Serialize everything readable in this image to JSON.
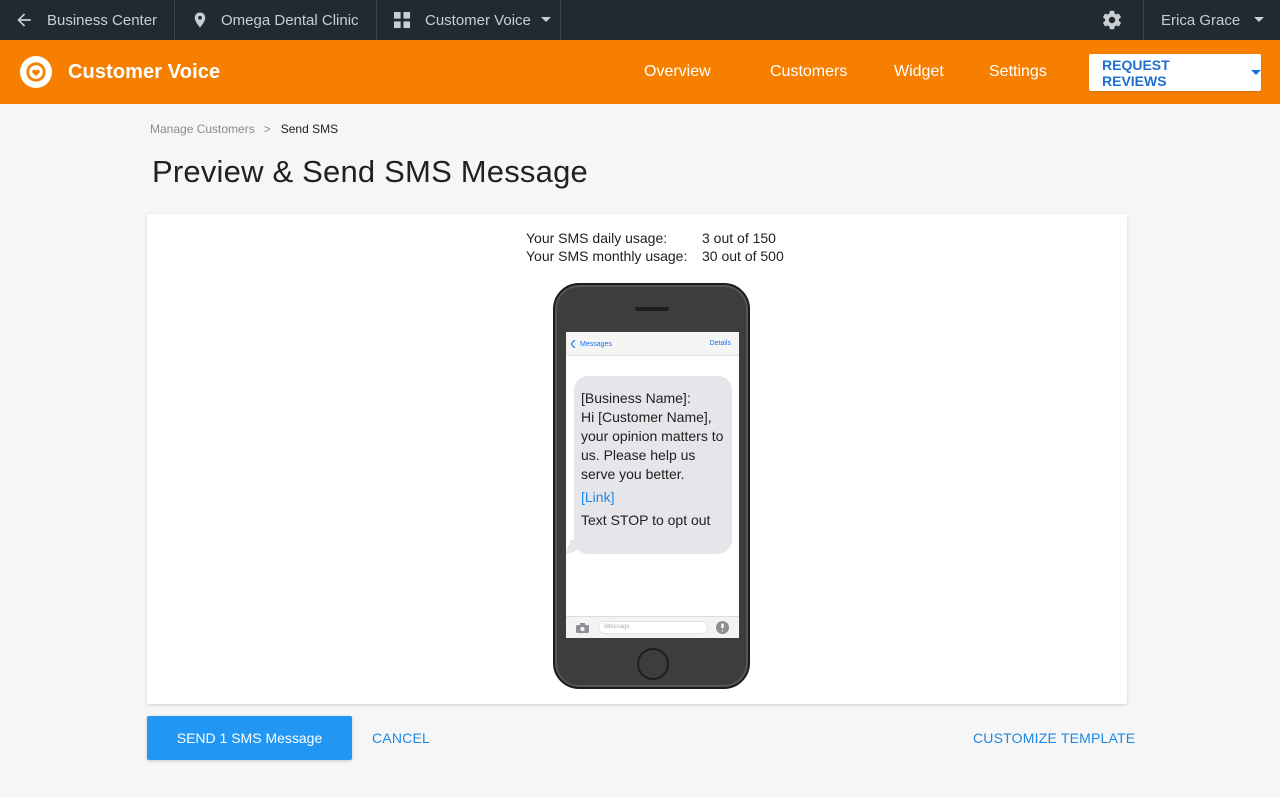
{
  "topbar": {
    "back_label": "Business Center",
    "location_label": "Omega Dental Clinic",
    "product_label": "Customer Voice",
    "user_name": "Erica Grace"
  },
  "nav": {
    "brand": "Customer Voice",
    "links": [
      "Overview",
      "Customers",
      "Widget",
      "Settings"
    ],
    "request_button": "REQUEST REVIEWS"
  },
  "breadcrumb": {
    "parent": "Manage Customers",
    "separator": ">",
    "current": "Send SMS"
  },
  "page_title": "Preview & Send SMS Message",
  "usage": {
    "daily_label": "Your SMS daily usage:",
    "daily_value": "3 out of 150",
    "monthly_label": "Your SMS monthly usage:",
    "monthly_value": "30 out of 500"
  },
  "phone": {
    "header_back": "Messages",
    "header_details": "Details",
    "message_lines": [
      "[Business Name]:",
      "Hi [Customer Name],",
      "your opinion matters to",
      "us. Please help us",
      "serve you better."
    ],
    "link_text": "[Link]",
    "optout_text": "Text STOP to opt out",
    "input_placeholder": "iMessage"
  },
  "actions": {
    "send_label": "SEND 1 SMS Message",
    "cancel_label": "CANCEL",
    "customize_label": "CUSTOMIZE TEMPLATE"
  },
  "colors": {
    "topbar": "#212a33",
    "brand_orange": "#f77f00",
    "primary_blue": "#2196f3",
    "link_blue": "#1e88e5"
  },
  "icons": [
    "arrow-back-icon",
    "location-pin-icon",
    "grid-apps-icon",
    "caret-down-icon",
    "gear-icon",
    "heart-logo-icon",
    "camera-icon",
    "microphone-icon"
  ]
}
